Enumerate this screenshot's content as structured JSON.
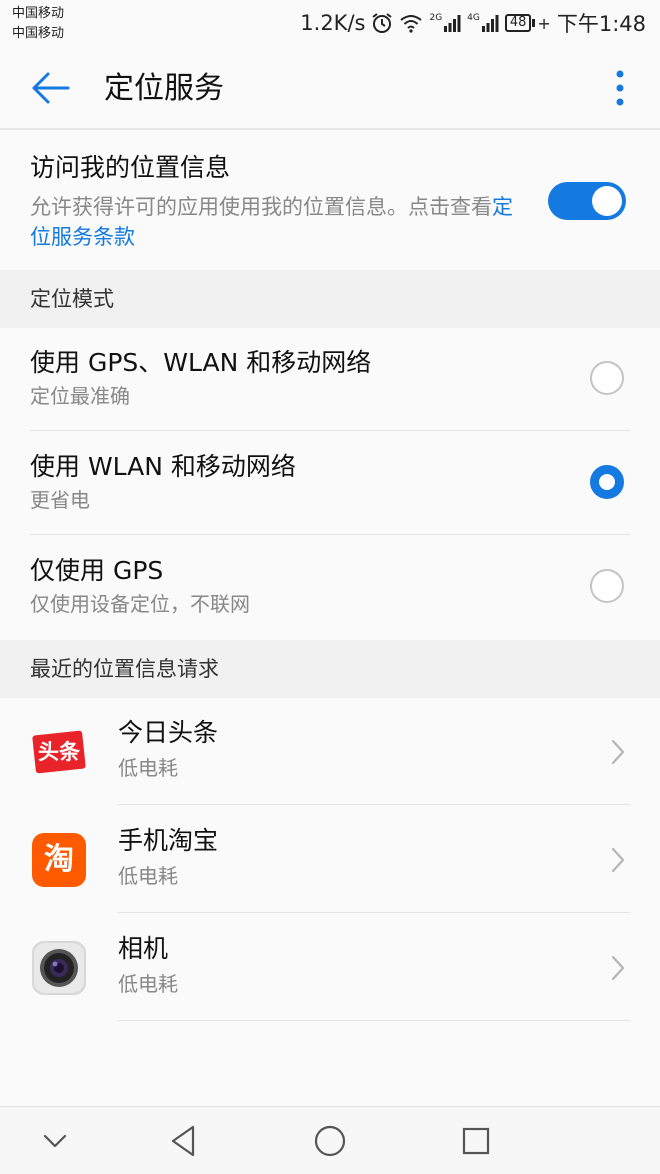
{
  "status_bar": {
    "carrier_1": "中国移动",
    "carrier_2": "中国移动",
    "network_speed": "1.2K/s",
    "signal_1_type": "2G",
    "signal_2_type": "4G",
    "battery_level": "48",
    "time": "下午1:48"
  },
  "app_bar": {
    "title": "定位服务"
  },
  "location_access": {
    "title": "访问我的位置信息",
    "description": "允许获得许可的应用使用我的位置信息。点击查看",
    "link_text": "定位服务条款",
    "enabled": true
  },
  "mode_section": {
    "header": "定位模式",
    "options": [
      {
        "title": "使用 GPS、WLAN 和移动网络",
        "subtitle": "定位最准确",
        "selected": false
      },
      {
        "title": "使用 WLAN 和移动网络",
        "subtitle": "更省电",
        "selected": true
      },
      {
        "title": "仅使用 GPS",
        "subtitle": "仅使用设备定位，不联网",
        "selected": false
      }
    ]
  },
  "recent_section": {
    "header": "最近的位置信息请求",
    "apps": [
      {
        "name": "今日头条",
        "usage": "低电耗",
        "icon": "toutiao-icon",
        "icon_text": "头条"
      },
      {
        "name": "手机淘宝",
        "usage": "低电耗",
        "icon": "taobao-icon",
        "icon_text": "淘"
      },
      {
        "name": "相机",
        "usage": "低电耗",
        "icon": "camera-icon"
      }
    ]
  },
  "colors": {
    "accent": "#1479e0",
    "toutiao_red": "#e8232a",
    "taobao_orange": "#ff5a00"
  }
}
